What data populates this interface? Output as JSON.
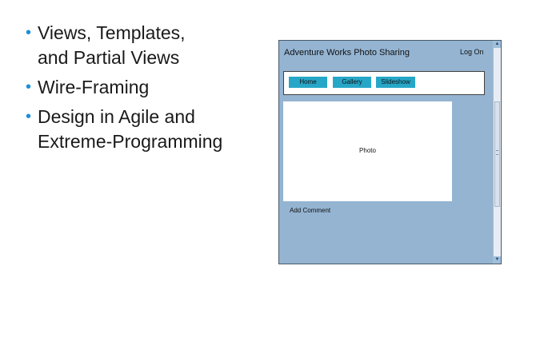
{
  "bullets": [
    {
      "text": "Views, Templates,\nand Partial Views"
    },
    {
      "text": "Wire-Framing"
    },
    {
      "text": "Design in Agile and\nExtreme-Programming"
    }
  ],
  "wireframe": {
    "site_title": "Adventure Works Photo Sharing",
    "login": "Log On",
    "nav": [
      "Home",
      "Gallery",
      "Slideshow"
    ],
    "photo_label": "Photo",
    "comment_label": "Add Comment"
  },
  "colors": {
    "bullet": "#1c8fd8",
    "wireframe_background": "#94b4d2",
    "nav_button": "#26a7c7"
  }
}
